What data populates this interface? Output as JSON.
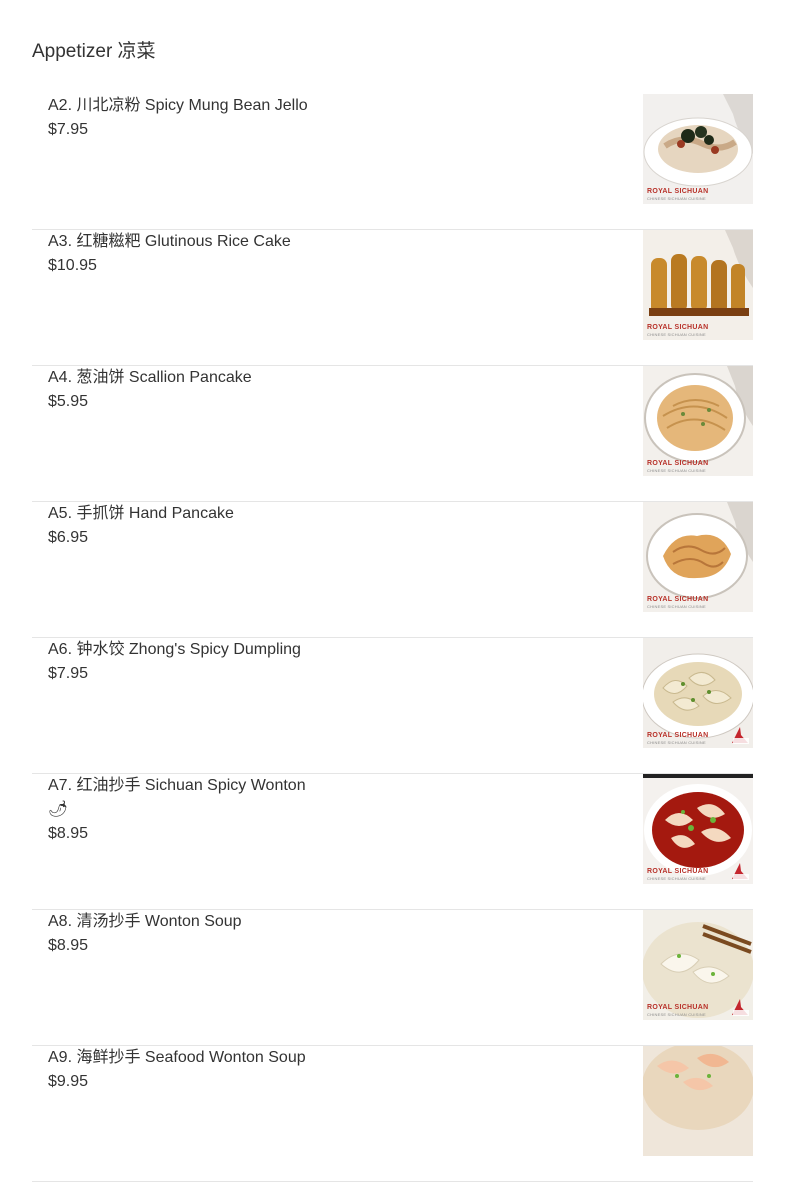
{
  "section": {
    "title": "Appetizer 凉菜"
  },
  "thumb_logo": {
    "brand": "ROYAL SICHUAN",
    "tagline": "CHINESE SICHUAN CUISINE"
  },
  "items": [
    {
      "name": "A2. 川北凉粉 Spicy Mung Bean Jello",
      "price": "$7.95",
      "spicy_icon": "",
      "image": "mung-bean-jello-photo"
    },
    {
      "name": "A3. 红糖糍粑 Glutinous Rice Cake",
      "price": "$10.95",
      "spicy_icon": "",
      "image": "rice-cake-photo"
    },
    {
      "name": "A4. 葱油饼 Scallion Pancake",
      "price": "$5.95",
      "spicy_icon": "",
      "image": "scallion-pancake-photo"
    },
    {
      "name": "A5. 手抓饼 Hand Pancake",
      "price": "$6.95",
      "spicy_icon": "",
      "image": "hand-pancake-photo"
    },
    {
      "name": "A6. 钟水饺 Zhong's Spicy Dumpling",
      "price": "$7.95",
      "spicy_icon": "",
      "image": "spicy-dumpling-photo"
    },
    {
      "name": "A7. 红油抄手 Sichuan Spicy Wonton",
      "price": "$8.95",
      "spicy_icon": "🌶",
      "image": "spicy-wonton-photo"
    },
    {
      "name": "A8. 清汤抄手 Wonton Soup",
      "price": "$8.95",
      "spicy_icon": "",
      "image": "wonton-soup-photo"
    },
    {
      "name": "A9. 海鲜抄手 Seafood Wonton Soup",
      "price": "$9.95",
      "spicy_icon": "",
      "image": "seafood-wonton-soup-photo"
    }
  ],
  "colors": {
    "text": "#333333",
    "divider": "#e5e5e5",
    "brand_red": "#b8322a"
  }
}
